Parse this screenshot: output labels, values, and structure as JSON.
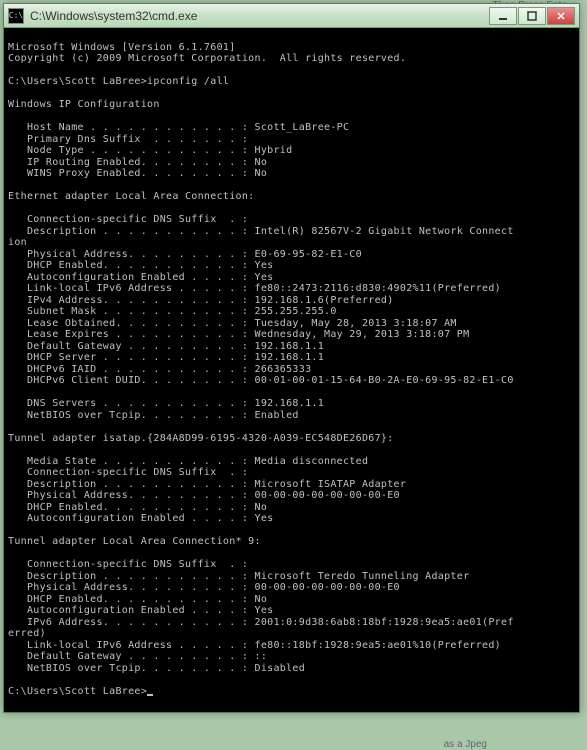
{
  "window": {
    "title": "C:\\Windows\\system32\\cmd.exe",
    "icon_label": "C:\\"
  },
  "background_hints": {
    "top_right": "Then Press Ente",
    "bottom": "as a Jpeg"
  },
  "terminal": {
    "lines": [
      "",
      "Microsoft Windows [Version 6.1.7601]",
      "Copyright (c) 2009 Microsoft Corporation.  All rights reserved.",
      "",
      "C:\\Users\\Scott LaBree>ipconfig /all",
      "",
      "Windows IP Configuration",
      "",
      "   Host Name . . . . . . . . . . . . : Scott_LaBree-PC",
      "   Primary Dns Suffix  . . . . . . . :",
      "   Node Type . . . . . . . . . . . . : Hybrid",
      "   IP Routing Enabled. . . . . . . . : No",
      "   WINS Proxy Enabled. . . . . . . . : No",
      "",
      "Ethernet adapter Local Area Connection:",
      "",
      "   Connection-specific DNS Suffix  . :",
      "   Description . . . . . . . . . . . : Intel(R) 82567V-2 Gigabit Network Connect",
      "ion",
      "   Physical Address. . . . . . . . . : E0-69-95-82-E1-C0",
      "   DHCP Enabled. . . . . . . . . . . : Yes",
      "   Autoconfiguration Enabled . . . . : Yes",
      "   Link-local IPv6 Address . . . . . : fe80::2473:2116:d830:4902%11(Preferred)",
      "   IPv4 Address. . . . . . . . . . . : 192.168.1.6(Preferred)",
      "   Subnet Mask . . . . . . . . . . . : 255.255.255.0",
      "   Lease Obtained. . . . . . . . . . : Tuesday, May 28, 2013 3:18:07 AM",
      "   Lease Expires . . . . . . . . . . : Wednesday, May 29, 2013 3:18:07 PM",
      "   Default Gateway . . . . . . . . . : 192.168.1.1",
      "   DHCP Server . . . . . . . . . . . : 192.168.1.1",
      "   DHCPv6 IAID . . . . . . . . . . . : 266365333",
      "   DHCPv6 Client DUID. . . . . . . . : 00-01-00-01-15-64-B0-2A-E0-69-95-82-E1-C0",
      "",
      "   DNS Servers . . . . . . . . . . . : 192.168.1.1",
      "   NetBIOS over Tcpip. . . . . . . . : Enabled",
      "",
      "Tunnel adapter isatap.{284A8D99-6195-4320-A039-EC548DE26D67}:",
      "",
      "   Media State . . . . . . . . . . . : Media disconnected",
      "   Connection-specific DNS Suffix  . :",
      "   Description . . . . . . . . . . . : Microsoft ISATAP Adapter",
      "   Physical Address. . . . . . . . . : 00-00-00-00-00-00-00-E0",
      "   DHCP Enabled. . . . . . . . . . . : No",
      "   Autoconfiguration Enabled . . . . : Yes",
      "",
      "Tunnel adapter Local Area Connection* 9:",
      "",
      "   Connection-specific DNS Suffix  . :",
      "   Description . . . . . . . . . . . : Microsoft Teredo Tunneling Adapter",
      "   Physical Address. . . . . . . . . : 00-00-00-00-00-00-00-E0",
      "   DHCP Enabled. . . . . . . . . . . : No",
      "   Autoconfiguration Enabled . . . . : Yes",
      "   IPv6 Address. . . . . . . . . . . : 2001:0:9d38:6ab8:18bf:1928:9ea5:ae01(Pref",
      "erred)",
      "   Link-local IPv6 Address . . . . . : fe80::18bf:1928:9ea5:ae01%10(Preferred)",
      "   Default Gateway . . . . . . . . . : ::",
      "   NetBIOS over Tcpip. . . . . . . . : Disabled",
      "",
      "C:\\Users\\Scott LaBree>"
    ]
  }
}
